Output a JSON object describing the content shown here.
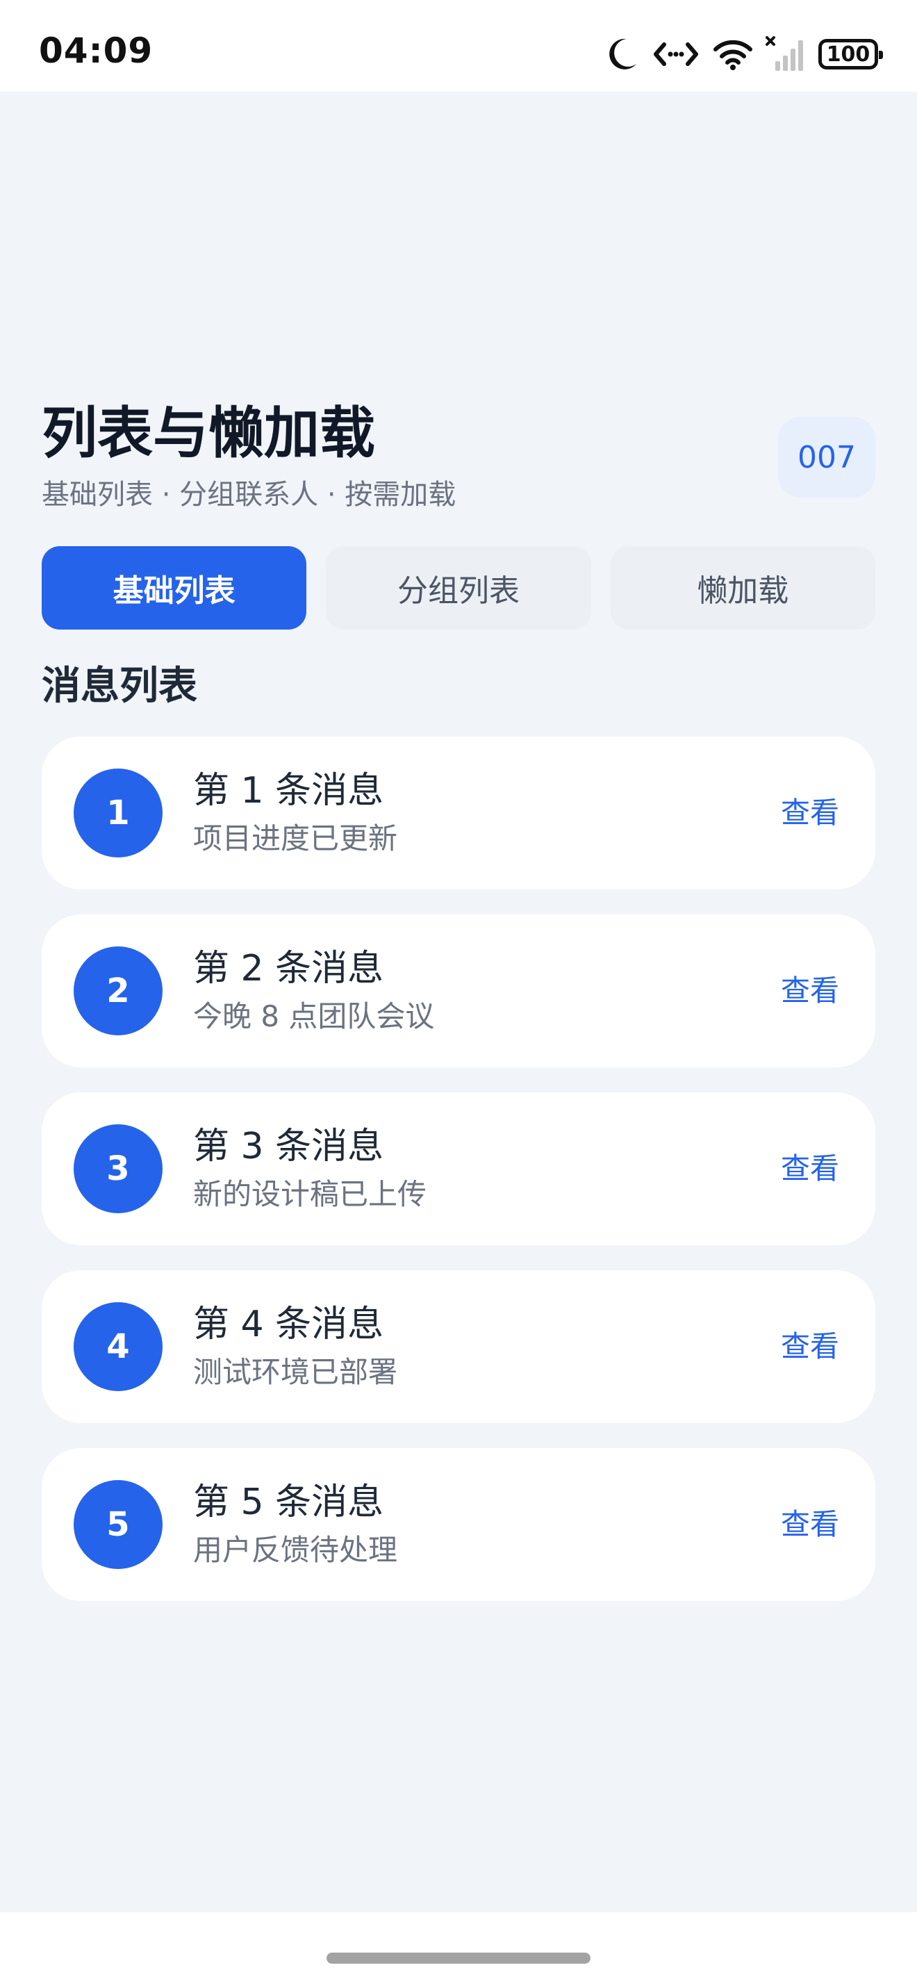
{
  "status_bar": {
    "time": "04:09",
    "battery": "100",
    "icons": [
      "moon-icon",
      "data-transfer-icon",
      "wifi-icon",
      "cellular-signal-icon",
      "battery-icon"
    ]
  },
  "header": {
    "title": "列表与懒加载",
    "subtitle": "基础列表 · 分组联系人 · 按需加载",
    "counter": "007"
  },
  "tabs": [
    {
      "label": "基础列表",
      "active": true
    },
    {
      "label": "分组列表",
      "active": false
    },
    {
      "label": "懒加载",
      "active": false
    }
  ],
  "section": {
    "title": "消息列表"
  },
  "messages": [
    {
      "index": "1",
      "title": "第 1 条消息",
      "desc": "项目进度已更新",
      "action": "查看"
    },
    {
      "index": "2",
      "title": "第 2 条消息",
      "desc": "今晚 8 点团队会议",
      "action": "查看"
    },
    {
      "index": "3",
      "title": "第 3 条消息",
      "desc": "新的设计稿已上传",
      "action": "查看"
    },
    {
      "index": "4",
      "title": "第 4 条消息",
      "desc": "测试环境已部署",
      "action": "查看"
    },
    {
      "index": "5",
      "title": "第 5 条消息",
      "desc": "用户反馈待处理",
      "action": "查看"
    }
  ],
  "colors": {
    "accent": "#2563EB",
    "background": "#F1F4F9",
    "card": "#FFFFFF",
    "text_primary": "#1F2937",
    "text_secondary": "#6B7280"
  }
}
